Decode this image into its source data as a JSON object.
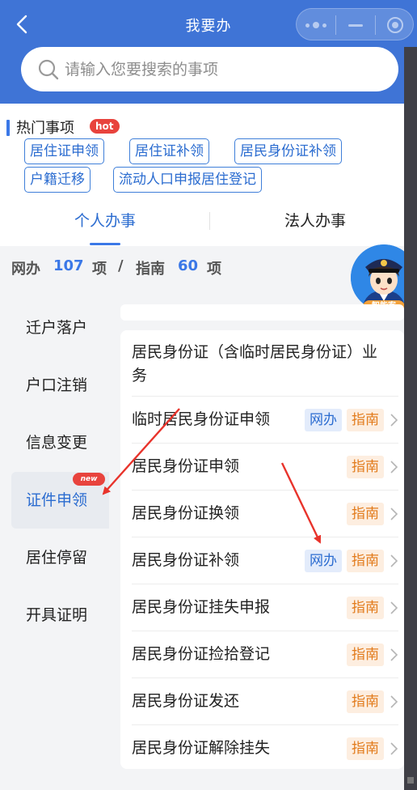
{
  "header": {
    "title": "我要办"
  },
  "search": {
    "placeholder": "请输入您要搜索的事项"
  },
  "hot": {
    "title": "热门事项",
    "badge": "hot",
    "tags": [
      "居住证申领",
      "居住证补领",
      "居民身份证补领",
      "户籍迁移",
      "流动人口申报居住登记"
    ]
  },
  "tabs": {
    "personal": "个人办事",
    "legal": "法人办事"
  },
  "counts": {
    "online_label": "网办",
    "online_count": "107",
    "unit": "项",
    "separator": "/",
    "guide_label": "指南",
    "guide_count": "60"
  },
  "assistant": {
    "label": "智能客"
  },
  "menu": {
    "items": [
      "迁户落户",
      "户口注销",
      "信息变更",
      "证件申领",
      "居住停留",
      "开具证明"
    ],
    "active_index": 3,
    "new_badge": "new"
  },
  "services": [
    {
      "name": "居民身份证（含临时居民身份证）业务",
      "online": false,
      "guide": false
    },
    {
      "name": "临时居民身份证申领",
      "online": true,
      "guide": true
    },
    {
      "name": "居民身份证申领",
      "online": false,
      "guide": true
    },
    {
      "name": "居民身份证换领",
      "online": false,
      "guide": true
    },
    {
      "name": "居民身份证补领",
      "online": true,
      "guide": true
    },
    {
      "name": "居民身份证挂失申报",
      "online": false,
      "guide": true
    },
    {
      "name": "居民身份证捡拾登记",
      "online": false,
      "guide": true
    },
    {
      "name": "居民身份证发还",
      "online": false,
      "guide": true
    },
    {
      "name": "居民身份证解除挂失",
      "online": false,
      "guide": true
    }
  ],
  "pill_labels": {
    "online": "网办",
    "guide": "指南"
  },
  "colors": {
    "header": "#3f74d6",
    "accent": "#3b78e7",
    "badge": "#e8433d",
    "guide": "#e27b1b",
    "arrow": "#e8332b"
  }
}
